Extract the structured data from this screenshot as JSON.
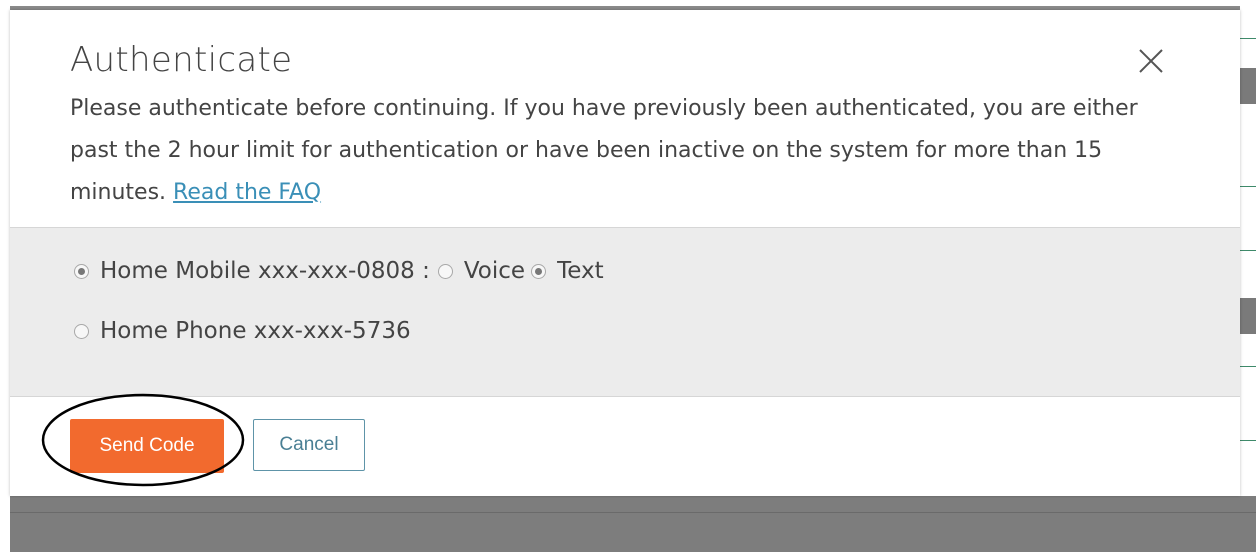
{
  "modal": {
    "title": "Authenticate",
    "message": "Please authenticate before continuing. If you have previously been authenticated, you are either past the 2 hour limit for authentication or have been inactive on the system for more than 15 minutes.",
    "faq_link": "Read the FAQ",
    "close_icon": "close-icon"
  },
  "options": {
    "home_mobile": {
      "label": "Home Mobile xxx-xxx-0808 :",
      "selected": true,
      "methods": [
        {
          "label": "Voice",
          "selected": false
        },
        {
          "label": "Text",
          "selected": true
        }
      ]
    },
    "home_phone": {
      "label": "Home Phone xxx-xxx-5736",
      "selected": false
    }
  },
  "footer": {
    "send_label": "Send Code",
    "cancel_label": "Cancel"
  },
  "colors": {
    "primary_button": "#f26a2e",
    "link": "#3a8fb7",
    "panel_background": "#ececec"
  }
}
